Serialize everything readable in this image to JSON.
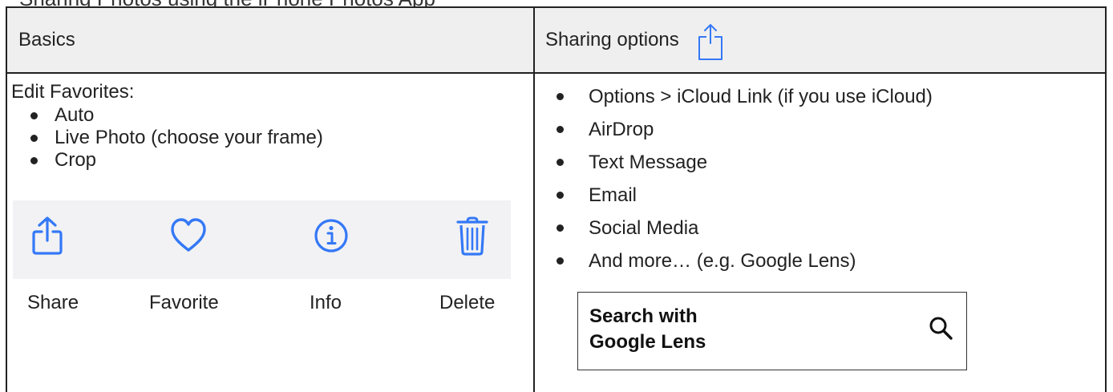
{
  "page_heading": "Sharing Photos using the iPhone Photos App",
  "header": {
    "basics_label": "Basics",
    "sharing_label": "Sharing options"
  },
  "basics": {
    "edit_title": "Edit Favorites:",
    "items": [
      "Auto",
      "Live Photo (choose your frame)",
      "Crop"
    ],
    "actions": [
      {
        "label": "Share",
        "icon": "share-icon"
      },
      {
        "label": "Favorite",
        "icon": "heart-icon"
      },
      {
        "label": "Info",
        "icon": "info-icon"
      },
      {
        "label": "Delete",
        "icon": "trash-icon"
      }
    ]
  },
  "sharing": {
    "items": [
      "Options > iCloud Link (if you use iCloud)",
      "AirDrop",
      "Text Message",
      "Email",
      "Social Media",
      "And more… (e.g. Google Lens)"
    ],
    "lens_button": {
      "line1": "Search with",
      "line2": "Google Lens",
      "icon": "search-icon"
    }
  },
  "colors": {
    "accent": "#3478f6",
    "header_bg": "#efefef",
    "action_bar_bg": "#f2f2f4"
  }
}
